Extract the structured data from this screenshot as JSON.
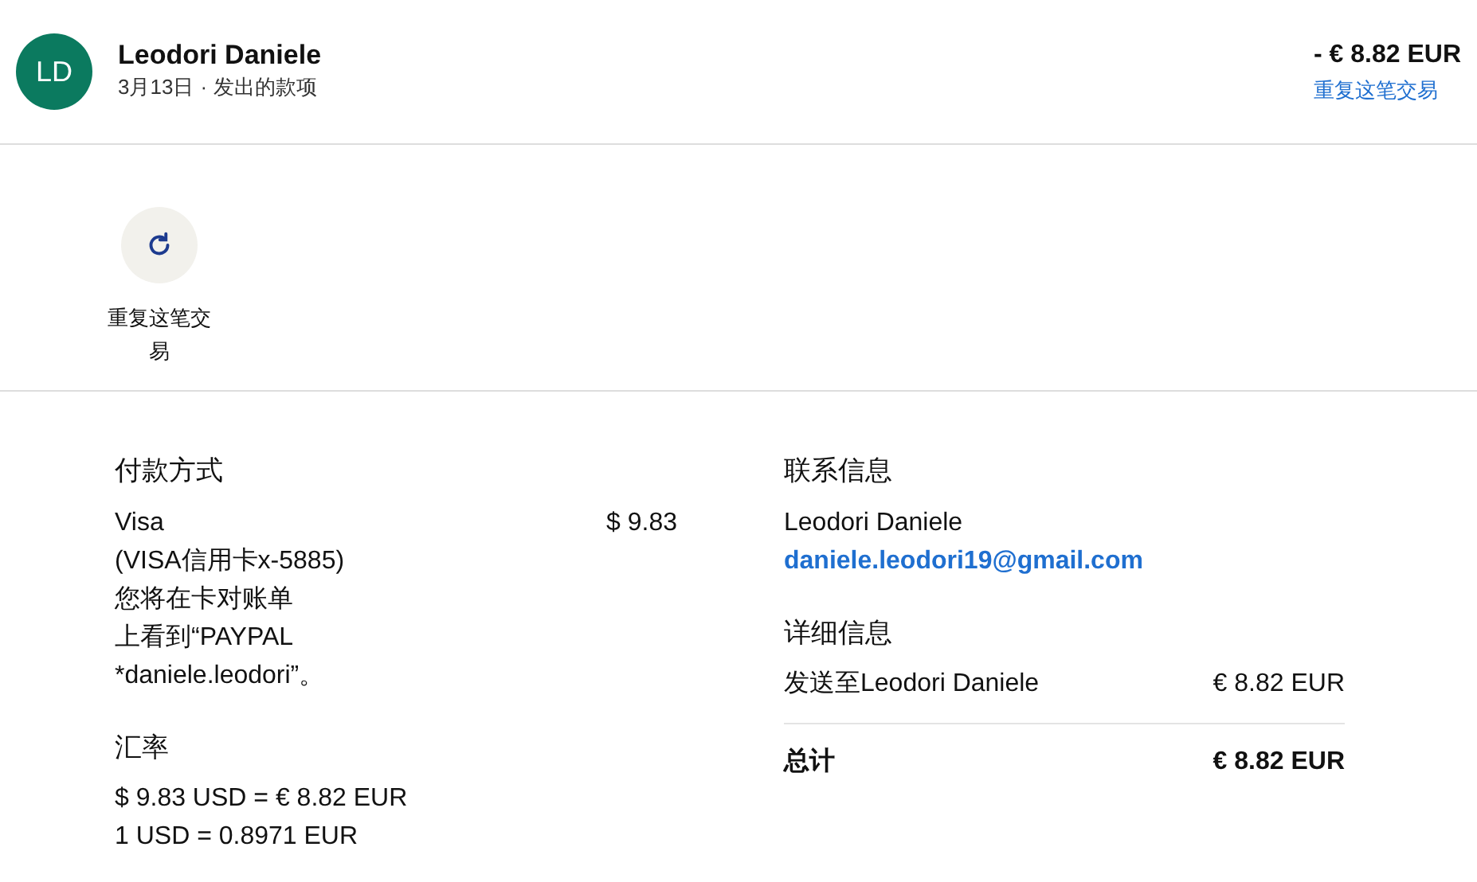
{
  "header": {
    "avatar": "LD",
    "name": "Leodori Daniele",
    "date": "3月13日",
    "separator": "·",
    "type": "发出的款项",
    "amount": "- € 8.82 EUR",
    "repeat_link": "重复这笔交易"
  },
  "actions": [
    {
      "kind": "repeat",
      "label": "重复这笔交易"
    }
  ],
  "payment": {
    "title": "付款方式",
    "lines": [
      "Visa",
      "(VISA信用卡x-5885)",
      "您将在卡对账单",
      "上看到“PAYPAL",
      "*daniele.leodori”。"
    ],
    "amount": "$ 9.83"
  },
  "exchange": {
    "title": "汇率",
    "lines": [
      "$ 9.83 USD = € 8.82 EUR",
      "1 USD = 0.8971 EUR"
    ]
  },
  "contact": {
    "title": "联系信息",
    "name": "Leodori Daniele",
    "email": "daniele.leodori19@gmail.com"
  },
  "details": {
    "title": "详细信息",
    "rows": [
      {
        "label": "发送至Leodori Daniele",
        "value": "€ 8.82 EUR"
      }
    ],
    "total": {
      "label": "总计",
      "value": "€ 8.82 EUR"
    }
  }
}
